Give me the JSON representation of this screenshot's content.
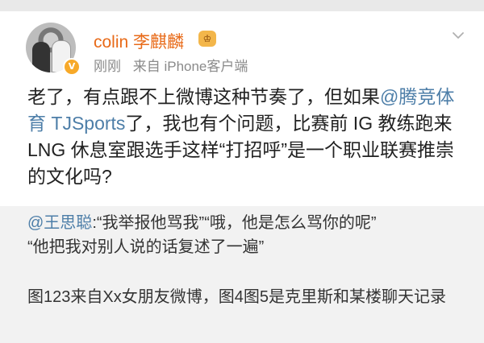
{
  "post": {
    "username": "colin 李麒麟",
    "level_badge": "♔",
    "time": "刚刚",
    "source": "来自 iPhone客户端",
    "content_parts": {
      "p1": "老了，有点跟不上微博这种节奏了，但如果",
      "mention": "@腾竞体育 TJSports",
      "p2": "了，我也有个问题，比赛前 IG 教练跑来LNG 休息室跟选手这样“打招呼”是一个职业联赛推崇的文化吗?"
    }
  },
  "repost": {
    "mention": "@王思聪",
    "line1_rest": ":“我举报他骂我”“哦，他是怎么骂你的呢”",
    "line2": "“他把我对别人说的话复述了一遍”",
    "note": "图123来自Xx女朋友微博，图4图5是克里斯和某楼聊天记录"
  },
  "colors": {
    "username": "#e86a18",
    "mention": "#4d7ea8"
  }
}
